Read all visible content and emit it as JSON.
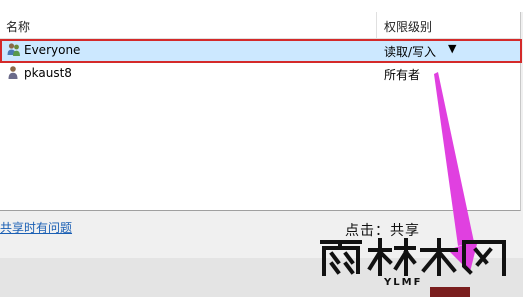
{
  "list": {
    "headers": {
      "name": "名称",
      "permission": "权限级别"
    },
    "rows": [
      {
        "name": "Everyone",
        "permission": "读取/写入",
        "selected": true,
        "icon": "group-icon",
        "dropdown_icon": "▼"
      },
      {
        "name": "pkaust8",
        "permission": "所有者",
        "selected": false,
        "icon": "user-icon"
      }
    ]
  },
  "footer": {
    "help_link": "共享时有问题"
  },
  "annotation": {
    "hint": "点击：共享",
    "highlight_color": "#d42a2a",
    "arrow_color": "#e040e0"
  },
  "watermark": {
    "text": "雨林木风",
    "sub": "YLMF"
  }
}
